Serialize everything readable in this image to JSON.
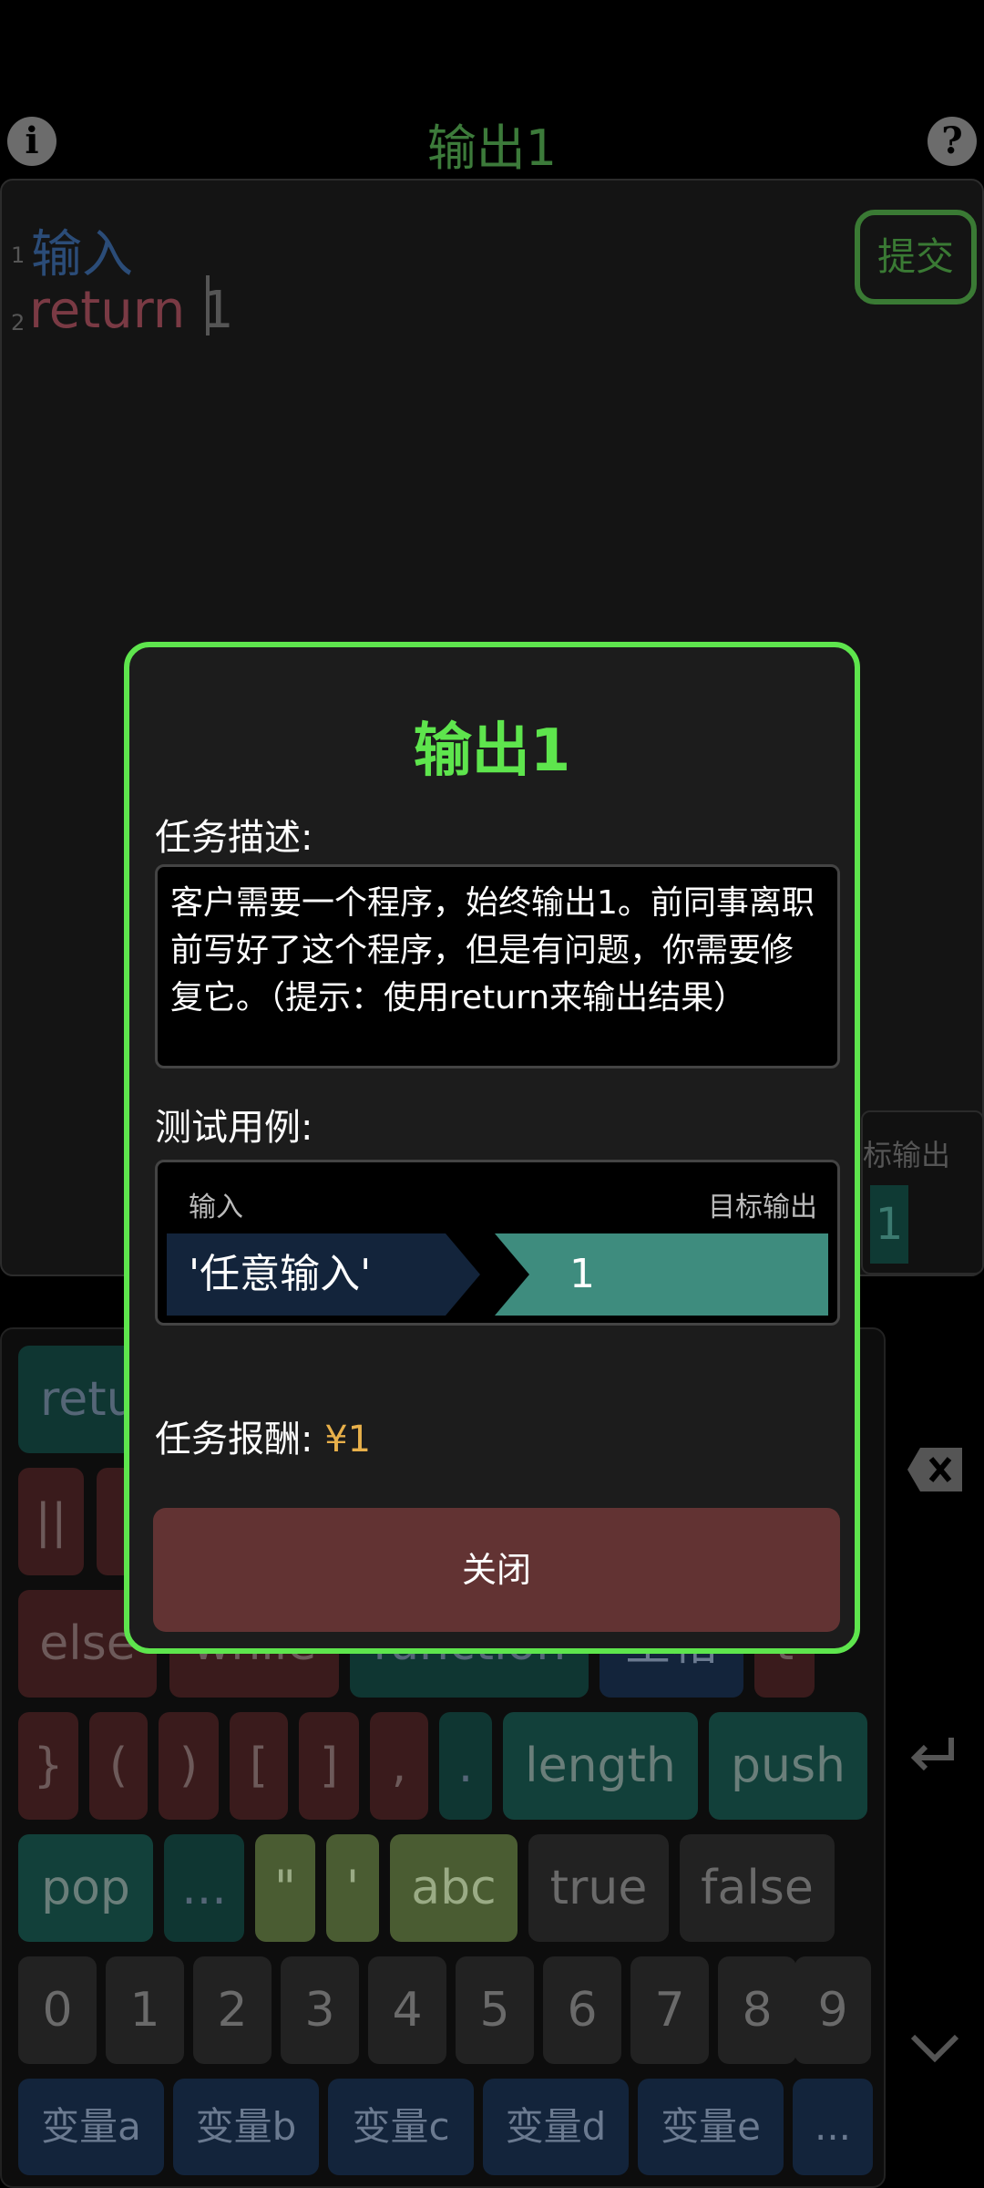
{
  "header": {
    "title": "输出1",
    "info_icon": "info-icon",
    "help_icon": "help-icon"
  },
  "editor": {
    "lines": [
      {
        "number": "1",
        "text": "输入"
      },
      {
        "number": "2",
        "keyword": "return",
        "value": "1"
      }
    ],
    "submit_label": "提交",
    "side_panel": {
      "label": "标输出",
      "value": "1"
    }
  },
  "keyboard": {
    "row1": [
      "retu"
    ],
    "row2": [
      "||"
    ],
    "row3": [
      "else",
      "while",
      "function",
      "空格",
      "t"
    ],
    "row4": [
      "}",
      "(",
      ")",
      "[",
      "]",
      ",",
      ".",
      "length",
      "push"
    ],
    "row5": [
      "pop",
      "...",
      "\"",
      "'",
      "abc",
      "true",
      "false"
    ],
    "row6": [
      "0",
      "1",
      "2",
      "3",
      "4",
      "5",
      "6",
      "7",
      "8",
      "9"
    ],
    "row7": [
      "变量a",
      "变量b",
      "变量c",
      "变量d",
      "变量e",
      "..."
    ],
    "side_icons": [
      "backspace-icon",
      "enter-icon",
      "chevron-down-icon"
    ]
  },
  "dialog": {
    "title": "输出1",
    "desc_label": "任务描述:",
    "description": "客户需要一个程序，始终输出1。前同事离职前写好了这个程序，但是有问题，你需要修复它。（提示：使用return来输出结果）",
    "test_label": "测试用例:",
    "test_header_input": "输入",
    "test_header_output": "目标输出",
    "test_input": "'任意输入'",
    "test_output": "1",
    "reward_label": "任务报酬:",
    "reward_value": "¥1",
    "close_label": "关闭"
  },
  "colors": {
    "accent": "#5ee54d",
    "navy": "#13243b",
    "teal": "#3e8c7e",
    "close": "#623333",
    "reward": "#e8b04a"
  }
}
